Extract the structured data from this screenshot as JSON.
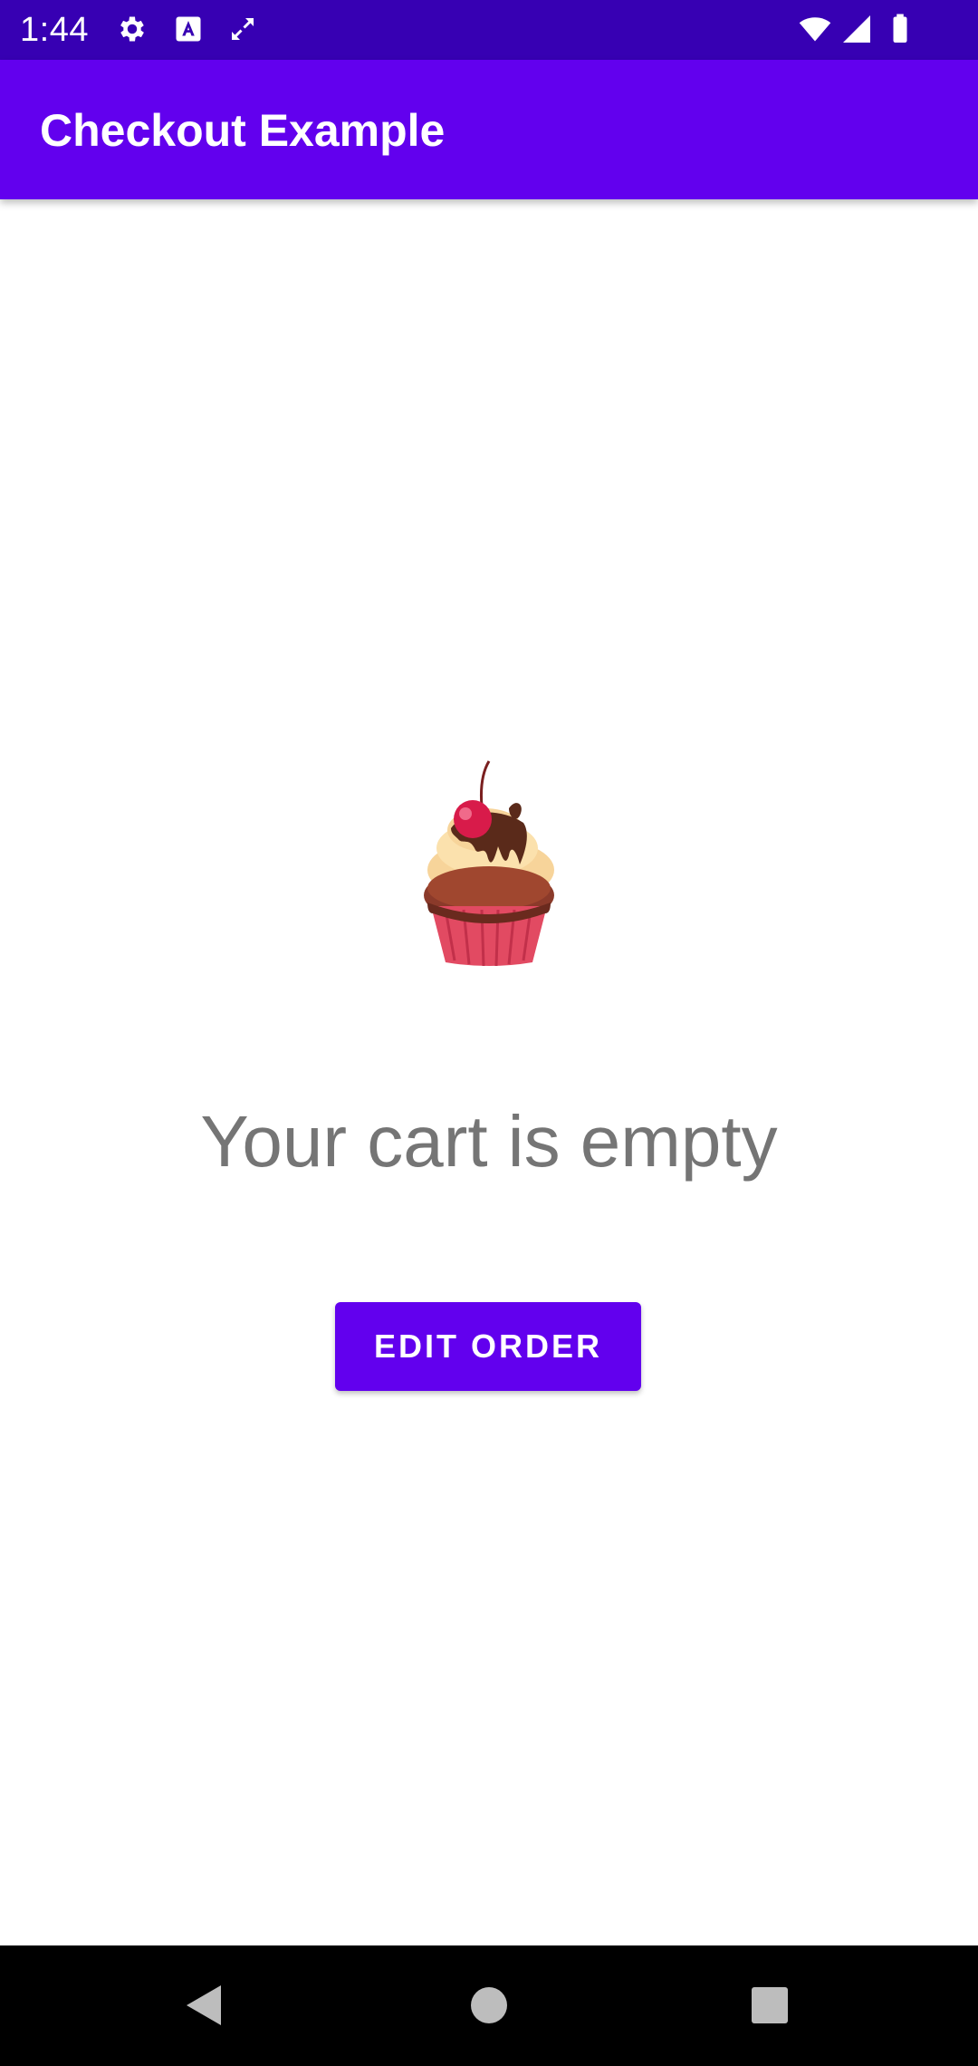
{
  "status_bar": {
    "time": "1:44",
    "icons": [
      "gear-icon",
      "text-a-icon",
      "sync-arrows-icon",
      "wifi-icon",
      "signal-icon",
      "battery-icon"
    ]
  },
  "app_bar": {
    "title": "Checkout Example"
  },
  "content": {
    "illustration": "cupcake-icon",
    "empty_message": "Your cart is empty",
    "edit_order_label": "EDIT ORDER"
  },
  "nav_bar": {
    "buttons": [
      "back-icon",
      "home-icon",
      "recents-icon"
    ]
  },
  "colors": {
    "status_bar": "#3700b3",
    "primary": "#6200ee",
    "text_secondary": "#757575",
    "nav_bar": "#000000"
  }
}
